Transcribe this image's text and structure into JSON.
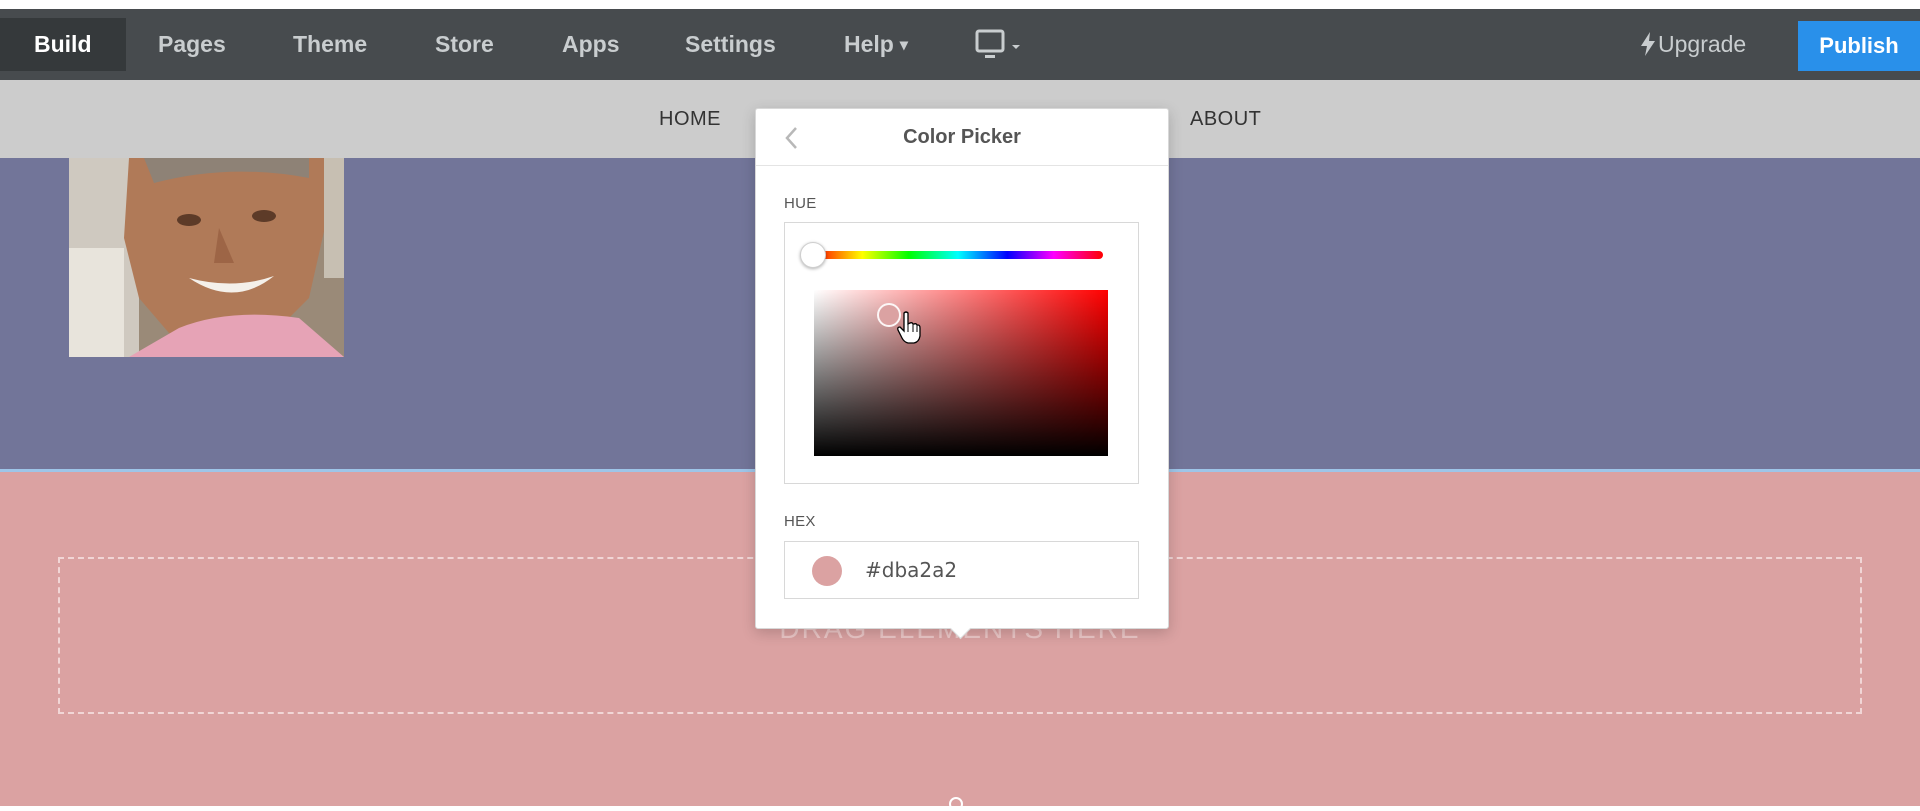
{
  "toolbar": {
    "tabs": [
      {
        "label": "Build"
      },
      {
        "label": "Pages"
      },
      {
        "label": "Theme"
      },
      {
        "label": "Store"
      },
      {
        "label": "Apps"
      },
      {
        "label": "Settings"
      },
      {
        "label": "Help",
        "caret": "▾"
      }
    ],
    "active_tab": "Build",
    "device_icon": "monitor-icon",
    "upgrade_label": "Upgrade",
    "upgrade_icon": "bolt-icon",
    "publish_label": "Publish",
    "publish_color": "#2990ea"
  },
  "site_nav": {
    "home_label": "HOME",
    "about_label": "ABOUT"
  },
  "hero": {
    "background": "#727599",
    "photo_icon": "profile-photo"
  },
  "content": {
    "background": "#dba2a2",
    "dropzone_label": "DRAG ELEMENTS HERE"
  },
  "color_picker": {
    "title": "Color Picker",
    "back_icon": "chevron-left-icon",
    "hue_label": "HUE",
    "hue_value": 0,
    "hex_label": "HEX",
    "hex_value": "#dba2a2",
    "swatch_color": "#dba2a2"
  }
}
